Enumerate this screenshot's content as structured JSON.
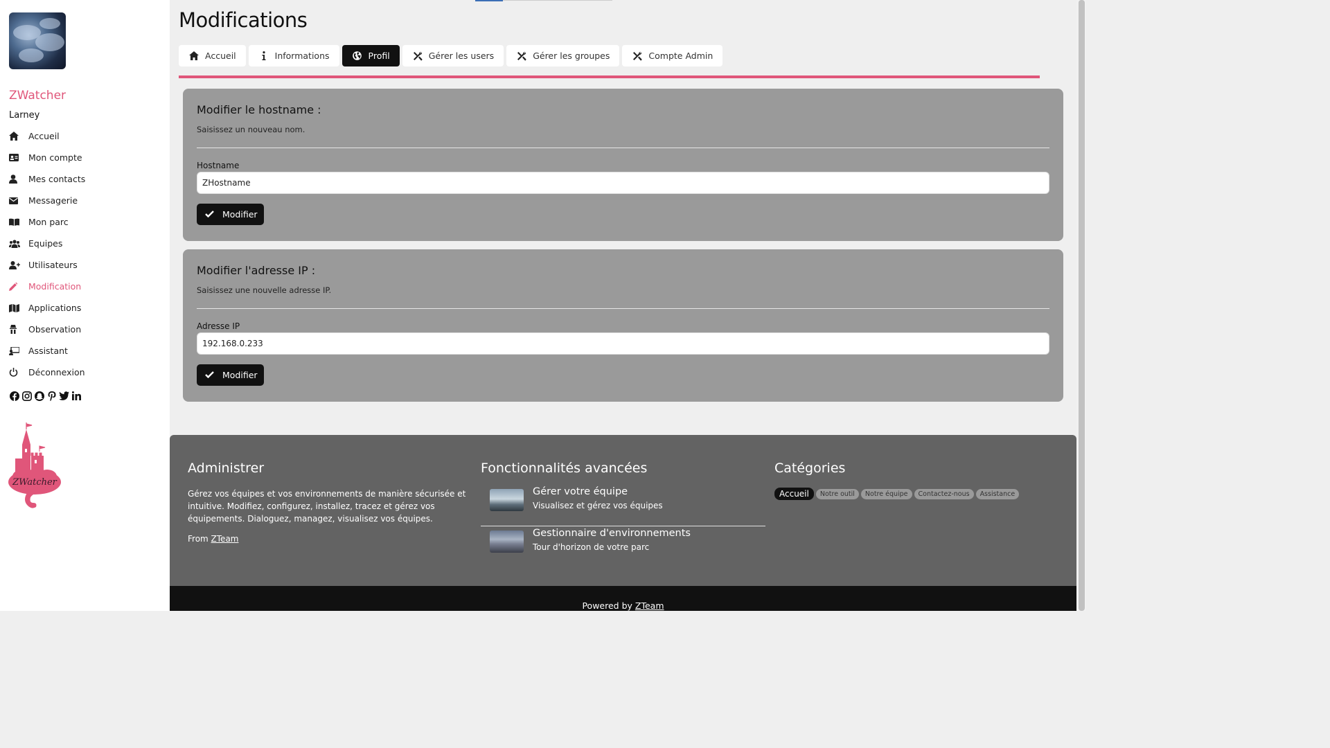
{
  "sidebar": {
    "brand": "ZWatcher",
    "username": "Larney",
    "nav": [
      {
        "label": "Accueil",
        "icon": "home-icon",
        "active": false
      },
      {
        "label": "Mon compte",
        "icon": "id-card-icon",
        "active": false
      },
      {
        "label": "Mes contacts",
        "icon": "user-icon",
        "active": false
      },
      {
        "label": "Messagerie",
        "icon": "envelope-icon",
        "active": false
      },
      {
        "label": "Mon parc",
        "icon": "book-icon",
        "active": false
      },
      {
        "label": "Equipes",
        "icon": "users-icon",
        "active": false
      },
      {
        "label": "Utilisateurs",
        "icon": "user-plus-icon",
        "active": false
      },
      {
        "label": "Modification",
        "icon": "pencil-icon",
        "active": true
      },
      {
        "label": "Applications",
        "icon": "map-icon",
        "active": false
      },
      {
        "label": "Observation",
        "icon": "observation-icon",
        "active": false
      },
      {
        "label": "Assistant",
        "icon": "assistant-icon",
        "active": false
      },
      {
        "label": "Déconnexion",
        "icon": "power-icon",
        "active": false
      }
    ],
    "accent_color": "#e0567a"
  },
  "page": {
    "title": "Modifications"
  },
  "tabs": [
    {
      "label": "Accueil",
      "icon": "home-icon",
      "active": false
    },
    {
      "label": "Informations",
      "icon": "info-icon",
      "active": false
    },
    {
      "label": "Profil",
      "icon": "globe-icon",
      "active": true
    },
    {
      "label": "Gérer les users",
      "icon": "tools-icon",
      "active": false
    },
    {
      "label": "Gérer les groupes",
      "icon": "tools-icon",
      "active": false
    },
    {
      "label": "Compte Admin",
      "icon": "tools-icon",
      "active": false
    }
  ],
  "hostname_card": {
    "title": "Modifier le hostname :",
    "subtitle": "Saisissez un nouveau nom.",
    "field_label": "Hostname",
    "field_value": "ZHostname",
    "button_label": "Modifier"
  },
  "ip_card": {
    "title": "Modifier l'adresse IP :",
    "subtitle": "Saisissez une nouvelle adresse IP.",
    "field_label": "Adresse IP",
    "field_value": "192.168.0.233",
    "button_label": "Modifier"
  },
  "footer": {
    "admin": {
      "title": "Administrer",
      "description": "Gérez vos équipes et vos environnements de manière sécurisée et intuitive. Modifiez, configurez, installez, tracez et gérez vos équipements. Dialoguez, managez, visualisez vos équipes.",
      "from_prefix": "From ",
      "from_link": "ZTeam"
    },
    "features": {
      "title": "Fonctionnalités avancées",
      "items": [
        {
          "title": "Gérer votre équipe",
          "subtitle": "Visualisez et gérez vos équipes"
        },
        {
          "title": "Gestionnaire d'environnements",
          "subtitle": "Tour d'horizon de votre parc"
        }
      ]
    },
    "categories": {
      "title": "Catégories",
      "badges": [
        "Accueil",
        "Notre outil",
        "Notre équipe",
        "Contactez-nous",
        "Assistance"
      ]
    }
  },
  "bottombar": {
    "prefix": "Powered by ",
    "link": "ZTeam"
  }
}
